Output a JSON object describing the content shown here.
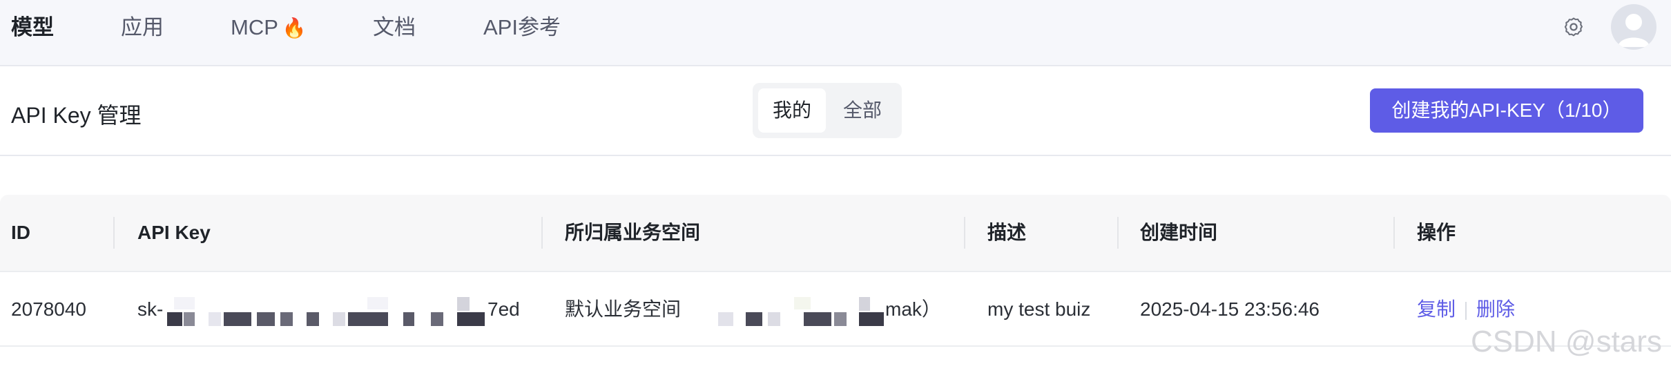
{
  "nav": {
    "items": [
      "模型",
      "应用",
      "MCP",
      "文档",
      "API参考"
    ],
    "mcp_badge": "🔥"
  },
  "header": {
    "title": "API Key 管理",
    "segment": [
      "我的",
      "全部"
    ],
    "segment_selected": "我的",
    "create_button": "创建我的API-KEY（1/10）"
  },
  "table": {
    "columns": [
      "ID",
      "API Key",
      "所归属业务空间",
      "描述",
      "创建时间",
      "操作"
    ],
    "rows": [
      {
        "id": "2078040",
        "api_key_prefix": "sk-",
        "api_key_suffix": "7ed",
        "workspace_prefix": "默认业务空间",
        "workspace_suffix": "mak）",
        "description": "my test buiz",
        "created_at": "2025-04-15 23:56:46",
        "actions": [
          "复制",
          "删除"
        ]
      }
    ]
  },
  "watermark": "CSDN @stars",
  "colors": {
    "accent": "#5e5ce6",
    "nav_bg": "#f6f7fb",
    "table_header_bg": "#f7f7f8"
  },
  "icons": [
    "gear-icon",
    "avatar-icon",
    "fire-icon"
  ]
}
